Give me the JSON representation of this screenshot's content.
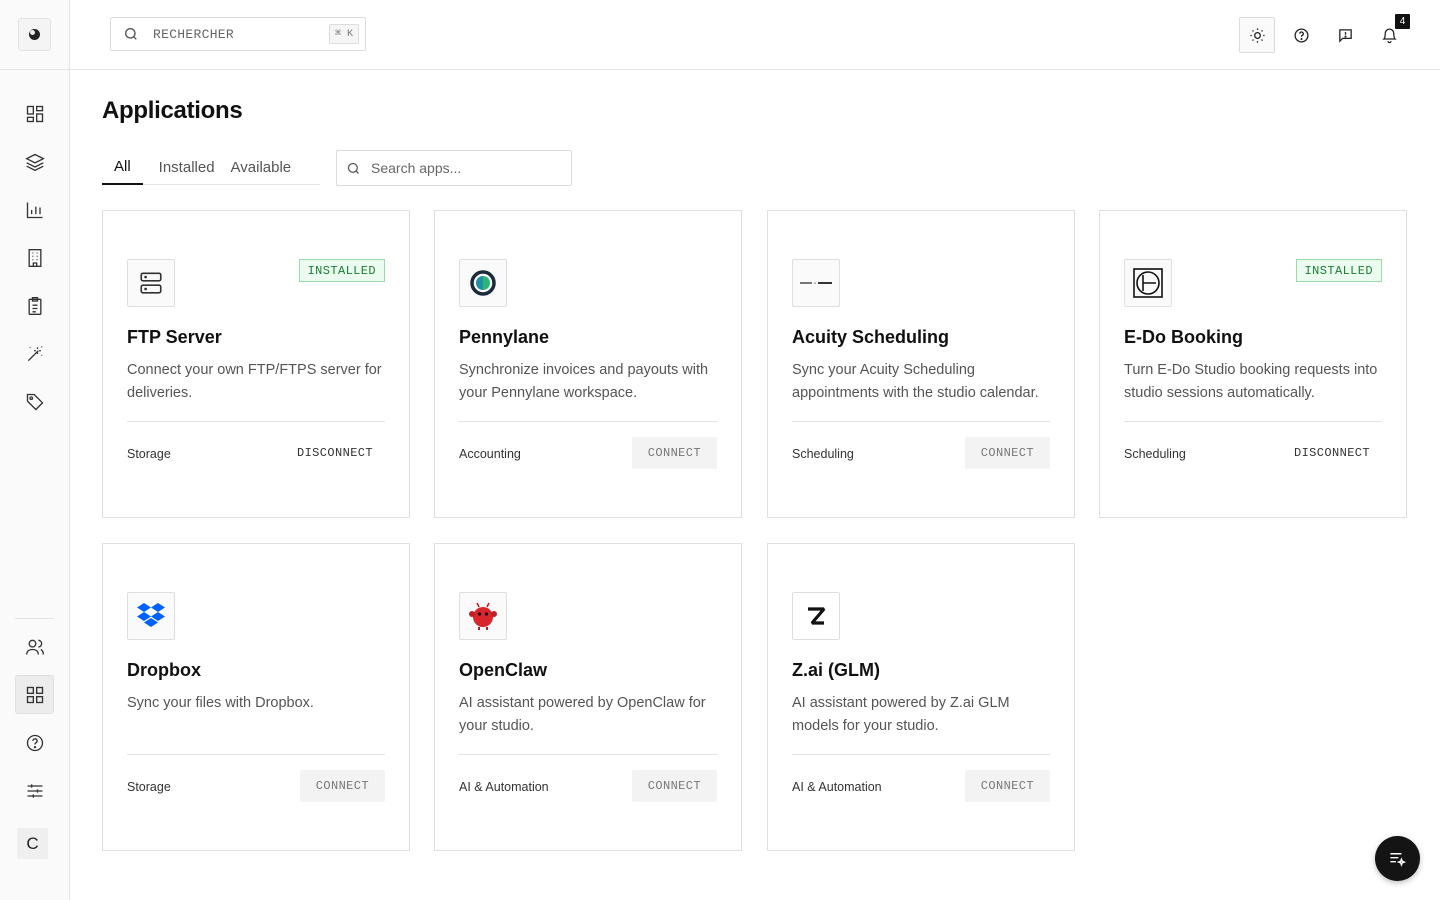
{
  "search": {
    "placeholder": "RECHERCHER",
    "shortcut": "⌘ K"
  },
  "notifications": {
    "count": "4"
  },
  "page": {
    "title": "Applications"
  },
  "tabs": [
    {
      "label": "All",
      "active": true
    },
    {
      "label": "Installed",
      "active": false
    },
    {
      "label": "Available",
      "active": false
    }
  ],
  "app_search": {
    "placeholder": "Search apps..."
  },
  "sidebar": {
    "avatar_letter": "C"
  },
  "apps": [
    {
      "name": "FTP Server",
      "description": "Connect your own FTP/FTPS server for deliveries.",
      "category": "Storage",
      "status": "INSTALLED",
      "action": "DISCONNECT",
      "icon": "server-icon"
    },
    {
      "name": "Pennylane",
      "description": "Synchronize invoices and payouts with your Pennylane workspace.",
      "category": "Accounting",
      "status": "",
      "action": "CONNECT",
      "icon": "pennylane-logo"
    },
    {
      "name": "Acuity Scheduling",
      "description": "Sync your Acuity Scheduling appointments with the studio calendar.",
      "category": "Scheduling",
      "status": "",
      "action": "CONNECT",
      "icon": "acuity-logo"
    },
    {
      "name": "E-Do Booking",
      "description": "Turn E-Do Studio booking requests into studio sessions automatically.",
      "category": "Scheduling",
      "status": "INSTALLED",
      "action": "DISCONNECT",
      "icon": "edo-logo"
    },
    {
      "name": "Dropbox",
      "description": "Sync your files with Dropbox.",
      "category": "Storage",
      "status": "",
      "action": "CONNECT",
      "icon": "dropbox-logo"
    },
    {
      "name": "OpenClaw",
      "description": "AI assistant powered by OpenClaw for your studio.",
      "category": "AI & Automation",
      "status": "",
      "action": "CONNECT",
      "icon": "openclaw-logo"
    },
    {
      "name": "Z.ai (GLM)",
      "description": "AI assistant powered by Z.ai GLM models for your studio.",
      "category": "AI & Automation",
      "status": "",
      "action": "CONNECT",
      "icon": "zai-logo"
    }
  ],
  "colors": {
    "installed_badge_bg": "#ecfbef",
    "installed_badge_text": "#1a7d33",
    "dropbox_blue": "#0061fe",
    "pennylane_green": "#1fa37a"
  }
}
